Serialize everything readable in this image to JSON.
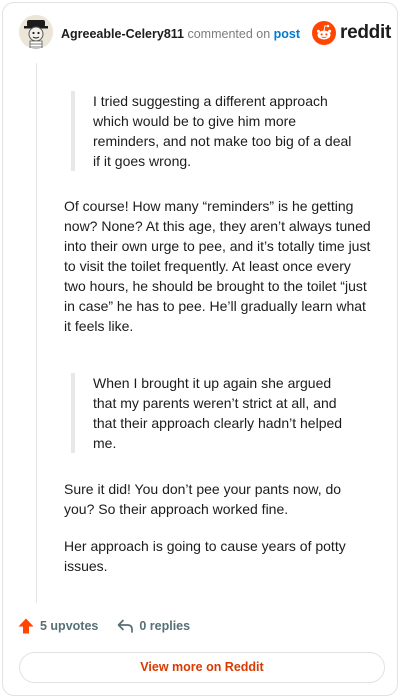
{
  "header": {
    "username": "Agreeable-Celery811",
    "commented_on": "commented on",
    "post_link": "post",
    "brand": "reddit"
  },
  "comment": {
    "quote1": [
      "I tried suggesting a different approach",
      "which would be to give him more",
      "reminders, and not make too big of a deal",
      "if it goes wrong."
    ],
    "para1": [
      "Of course! How many “reminders” is he getting",
      "now? None? At this age, they aren’t always tuned",
      "into their own urge to pee, and it’s totally time just",
      "to visit the toilet frequently. At least once every",
      "two hours, he should be brought to the toilet “just",
      "in case” he has to pee. He’ll gradually learn what",
      "it feels like."
    ],
    "quote2": [
      "When I brought it up again she argued",
      "that my parents weren’t strict at all, and",
      "that their approach clearly hadn’t helped",
      "me."
    ],
    "para2": [
      "Sure it did! You don’t pee your pants now, do",
      "you? So their approach worked fine."
    ],
    "para3": [
      "Her approach is going to cause years of potty",
      "issues."
    ]
  },
  "actions": {
    "upvotes": "5 upvotes",
    "replies": "0 replies"
  },
  "footer": {
    "view_more": "View more on Reddit"
  },
  "colors": {
    "accent": "#ff4500",
    "link": "#0079d3",
    "view_more": "#d93a00"
  },
  "icons": [
    "avatar",
    "reddit-logo-icon",
    "upvote-arrow-icon",
    "reply-icon"
  ]
}
